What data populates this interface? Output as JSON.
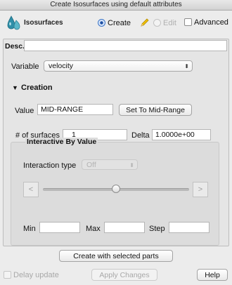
{
  "window": {
    "title": "Create Isosurfaces using default attributes"
  },
  "toolbar": {
    "app_label": "Isosurfaces",
    "create_label": "Create",
    "edit_label": "Edit",
    "advanced_label": "Advanced"
  },
  "desc": {
    "label": "Desc.",
    "value": ""
  },
  "variable": {
    "label": "Variable",
    "selected": "velocity"
  },
  "creation": {
    "header": "Creation",
    "value_label": "Value",
    "value": "MID-RANGE",
    "set_mid_label": "Set To Mid-Range",
    "num_surfaces_label": "# of surfaces",
    "num_surfaces": "1",
    "delta_label": "Delta",
    "delta": "1.0000e+00"
  },
  "interactive": {
    "title": "Interactive By Value",
    "interaction_type_label": "Interaction type",
    "interaction_type": "Off",
    "slider_value": 0.5,
    "prev_glyph": "<",
    "next_glyph": ">",
    "min_label": "Min",
    "max_label": "Max",
    "step_label": "Step",
    "min": "",
    "max": "",
    "step": ""
  },
  "footer": {
    "create_button": "Create with selected parts",
    "delay_update_label": "Delay update",
    "apply_changes_label": "Apply Changes",
    "help_label": "Help"
  },
  "colors": {
    "accent": "#3b74c7",
    "pencil": "#f2c200"
  },
  "icons": {
    "app": "water-drops-icon",
    "edit": "pencil-icon",
    "collapse": "disclosure-triangle-icon"
  }
}
